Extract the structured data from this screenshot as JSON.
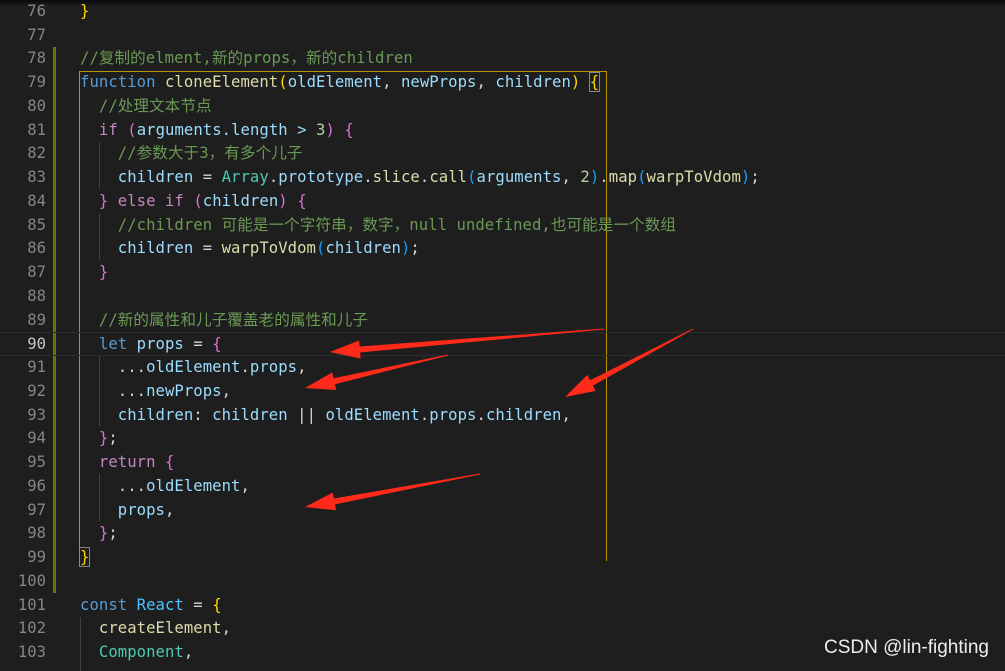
{
  "editor": {
    "current_line": 90,
    "colors": {
      "background": "#1e1e1e",
      "gutter_modified": "#587c0c",
      "annotation_arrow": "#ff2a1a"
    },
    "lines": [
      {
        "n": "76",
        "t": [
          [
            "}",
            "c-b1"
          ]
        ]
      },
      {
        "n": "77",
        "t": []
      },
      {
        "n": "78",
        "t": [
          [
            "//复制的elment,新的props，新的children",
            "c-comment"
          ]
        ]
      },
      {
        "n": "79",
        "t": [
          [
            "function",
            "c-kw"
          ],
          [
            " ",
            "c-p"
          ],
          [
            "cloneElement",
            "c-fn"
          ],
          [
            "(",
            "c-b1"
          ],
          [
            "oldElement",
            "c-var"
          ],
          [
            ", ",
            "c-p"
          ],
          [
            "newProps",
            "c-var"
          ],
          [
            ", ",
            "c-p"
          ],
          [
            "children",
            "c-var"
          ],
          [
            ")",
            "c-b1"
          ],
          [
            " ",
            "c-p"
          ],
          [
            "{",
            "c-b1 boxed"
          ]
        ]
      },
      {
        "n": "80",
        "t": [
          [
            "  //处理文本节点",
            "c-comment"
          ]
        ]
      },
      {
        "n": "81",
        "t": [
          [
            "  ",
            "c-p"
          ],
          [
            "if",
            "c-ctrl"
          ],
          [
            " ",
            "c-p"
          ],
          [
            "(",
            "c-b2"
          ],
          [
            "arguments",
            "c-var"
          ],
          [
            ".length > ",
            "c-var"
          ],
          [
            "3",
            "c-num"
          ],
          [
            ")",
            "c-b2"
          ],
          [
            " ",
            "c-p"
          ],
          [
            "{",
            "c-b2"
          ]
        ]
      },
      {
        "n": "82",
        "t": [
          [
            "    //参数大于3，有多个儿子",
            "c-comment"
          ]
        ]
      },
      {
        "n": "83",
        "t": [
          [
            "    ",
            "c-p"
          ],
          [
            "children",
            "c-var"
          ],
          [
            " = ",
            "c-p"
          ],
          [
            "Array",
            "c-cls"
          ],
          [
            ".",
            "c-p"
          ],
          [
            "prototype",
            "c-var"
          ],
          [
            ".",
            "c-p"
          ],
          [
            "slice",
            "c-fn"
          ],
          [
            ".",
            "c-p"
          ],
          [
            "call",
            "c-fn"
          ],
          [
            "(",
            "c-b3"
          ],
          [
            "arguments",
            "c-var"
          ],
          [
            ", ",
            "c-p"
          ],
          [
            "2",
            "c-num"
          ],
          [
            ")",
            "c-b3"
          ],
          [
            ".",
            "c-p"
          ],
          [
            "map",
            "c-fn"
          ],
          [
            "(",
            "c-b3"
          ],
          [
            "warpToVdom",
            "c-fn"
          ],
          [
            ")",
            "c-b3"
          ],
          [
            ";",
            "c-p"
          ]
        ]
      },
      {
        "n": "84",
        "t": [
          [
            "  ",
            "c-p"
          ],
          [
            "}",
            "c-b2"
          ],
          [
            " ",
            "c-p"
          ],
          [
            "else if",
            "c-ctrl"
          ],
          [
            " ",
            "c-p"
          ],
          [
            "(",
            "c-b2"
          ],
          [
            "children",
            "c-var"
          ],
          [
            ")",
            "c-b2"
          ],
          [
            " ",
            "c-p"
          ],
          [
            "{",
            "c-b2"
          ]
        ]
      },
      {
        "n": "85",
        "t": [
          [
            "    //children 可能是一个字符串，数字，null undefined,也可能是一个数组",
            "c-comment"
          ]
        ]
      },
      {
        "n": "86",
        "t": [
          [
            "    ",
            "c-p"
          ],
          [
            "children",
            "c-var"
          ],
          [
            " = ",
            "c-p"
          ],
          [
            "warpToVdom",
            "c-fn"
          ],
          [
            "(",
            "c-b3"
          ],
          [
            "children",
            "c-var"
          ],
          [
            ")",
            "c-b3"
          ],
          [
            ";",
            "c-p"
          ]
        ]
      },
      {
        "n": "87",
        "t": [
          [
            "  ",
            "c-p"
          ],
          [
            "}",
            "c-b2"
          ]
        ]
      },
      {
        "n": "88",
        "t": []
      },
      {
        "n": "89",
        "t": [
          [
            "  //新的属性和儿子覆盖老的属性和儿子",
            "c-comment"
          ]
        ]
      },
      {
        "n": "90",
        "t": [
          [
            "  ",
            "c-p"
          ],
          [
            "let",
            "c-kw"
          ],
          [
            " ",
            "c-p"
          ],
          [
            "props",
            "c-var"
          ],
          [
            " = ",
            "c-p"
          ],
          [
            "{",
            "c-b2"
          ]
        ]
      },
      {
        "n": "91",
        "t": [
          [
            "    ...",
            "c-p"
          ],
          [
            "oldElement",
            "c-var"
          ],
          [
            ".",
            "c-p"
          ],
          [
            "props",
            "c-var"
          ],
          [
            ",",
            "c-p"
          ]
        ]
      },
      {
        "n": "92",
        "t": [
          [
            "    ...",
            "c-p"
          ],
          [
            "newProps",
            "c-var"
          ],
          [
            ",",
            "c-p"
          ]
        ]
      },
      {
        "n": "93",
        "t": [
          [
            "    ",
            "c-p"
          ],
          [
            "children",
            "c-var"
          ],
          [
            ": ",
            "c-p"
          ],
          [
            "children",
            "c-var"
          ],
          [
            " || ",
            "c-p"
          ],
          [
            "oldElement",
            "c-var"
          ],
          [
            ".",
            "c-p"
          ],
          [
            "props",
            "c-var"
          ],
          [
            ".",
            "c-p"
          ],
          [
            "children",
            "c-var"
          ],
          [
            ",",
            "c-p"
          ]
        ]
      },
      {
        "n": "94",
        "t": [
          [
            "  ",
            "c-p"
          ],
          [
            "}",
            "c-b2"
          ],
          [
            ";",
            "c-p"
          ]
        ]
      },
      {
        "n": "95",
        "t": [
          [
            "  ",
            "c-p"
          ],
          [
            "return",
            "c-ctrl"
          ],
          [
            " ",
            "c-p"
          ],
          [
            "{",
            "c-b2"
          ]
        ]
      },
      {
        "n": "96",
        "t": [
          [
            "    ...",
            "c-p"
          ],
          [
            "oldElement",
            "c-var"
          ],
          [
            ",",
            "c-p"
          ]
        ]
      },
      {
        "n": "97",
        "t": [
          [
            "    ",
            "c-p"
          ],
          [
            "props",
            "c-var"
          ],
          [
            ",",
            "c-p"
          ]
        ]
      },
      {
        "n": "98",
        "t": [
          [
            "  ",
            "c-p"
          ],
          [
            "}",
            "c-b2"
          ],
          [
            ";",
            "c-p"
          ]
        ]
      },
      {
        "n": "99",
        "t": [
          [
            "}",
            "c-b1 boxed"
          ]
        ]
      },
      {
        "n": "100",
        "t": []
      },
      {
        "n": "101",
        "t": [
          [
            "const",
            "c-kw"
          ],
          [
            " ",
            "c-p"
          ],
          [
            "React",
            "c-const"
          ],
          [
            " = ",
            "c-p"
          ],
          [
            "{",
            "c-b1"
          ]
        ]
      },
      {
        "n": "102",
        "t": [
          [
            "  ",
            "c-p"
          ],
          [
            "createElement",
            "c-fn"
          ],
          [
            ",",
            "c-p"
          ]
        ]
      },
      {
        "n": "103",
        "t": [
          [
            "  ",
            "c-p"
          ],
          [
            "Component",
            "c-cls"
          ],
          [
            ",",
            "c-p"
          ]
        ]
      }
    ]
  },
  "watermark": "CSDN @lin-fighting"
}
